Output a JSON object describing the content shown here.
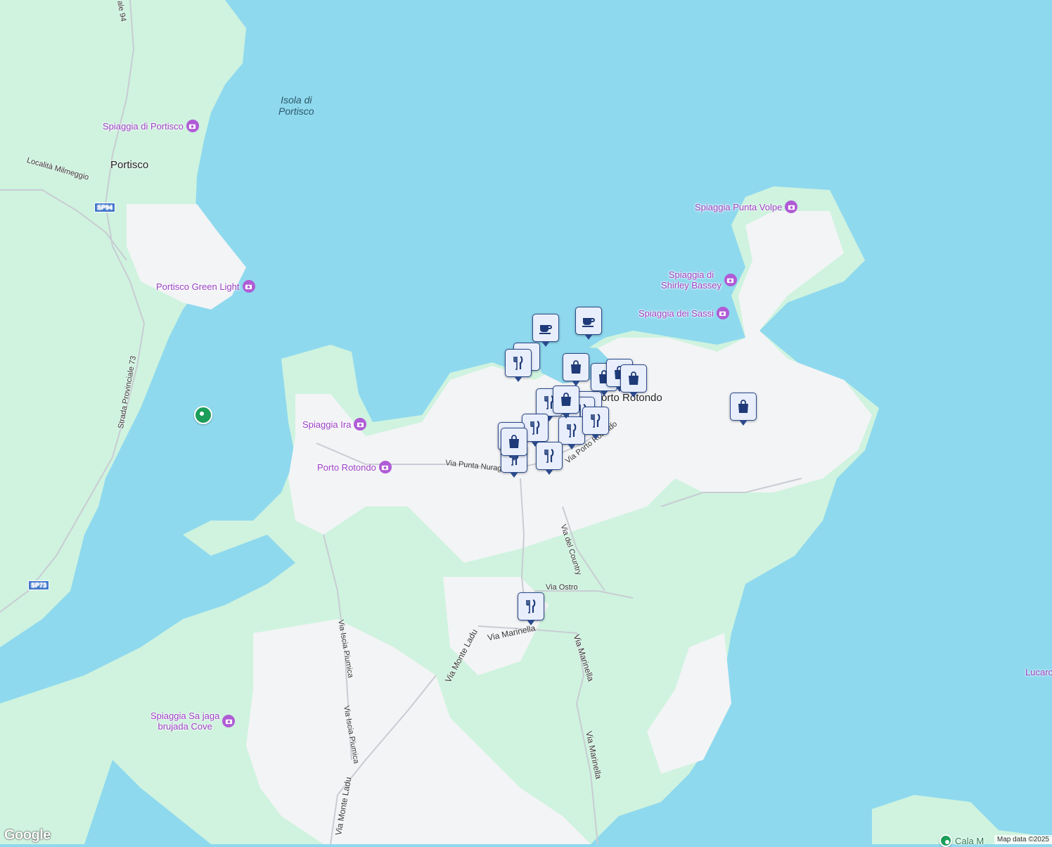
{
  "map": {
    "colors": {
      "water": "#8fd9ee",
      "land": "#f3f4f6",
      "park": "#cff3df",
      "road": "#c9ccd3",
      "poi": "#9a3fc4",
      "pin_border": "#2b4a8c",
      "pin_fill": "#e8eefc"
    },
    "place_labels": {
      "portisco": "Portisco",
      "porto_rotondo": "Porto Rotondo",
      "isola": "Isola di\nPortisco",
      "lucaro": "Lucaro"
    },
    "poi_labels": {
      "spiaggia_portisco": "Spiaggia di Portisco",
      "portisco_green_light": "Portisco Green Light",
      "spiaggia_punta_volpe": "Spiaggia Punta Volpe",
      "spiaggia_shirley_1": "Spiaggia di",
      "spiaggia_shirley_2": "Shirley Bassey",
      "spiaggia_sassi": "Spiaggia dei Sassi",
      "spiaggia_ira": "Spiaggia Ira",
      "porto_rotondo_poi": "Porto Rotondo",
      "sa_jaga_1": "Spiaggia Sa jaga",
      "sa_jaga_2": "brujada Cove",
      "cala_partial": "Cala M"
    },
    "road_labels": {
      "milmeggio": "Località Milmeggio",
      "sp94": "SP94",
      "sp73": "SP73",
      "provinciale_94": "ale 94",
      "provinciale_73": "Strada Provinciale 73",
      "punta_nuraghe": "Via Punta Nuraghe",
      "porto_rotondo_via": "Via Porto Rotondo",
      "del_country": "Via del Country",
      "ostro": "Via Ostro",
      "marinella_1": "Via Marinella",
      "marinella_2": "Via Marinella",
      "marinella_3": "Via Marinella",
      "monte_ladu_1": "Via Monte Ladu",
      "monte_ladu_2": "Via Monte Ladu",
      "iscia_1": "Via Iscia Piumica",
      "iscia_2": "Via Iscia Piumica"
    },
    "markers": [
      {
        "type": "cafe"
      },
      {
        "type": "cafe"
      },
      {
        "type": "restaurant"
      },
      {
        "type": "restaurant"
      },
      {
        "type": "restaurant"
      },
      {
        "type": "restaurant"
      },
      {
        "type": "restaurant"
      },
      {
        "type": "restaurant"
      },
      {
        "type": "restaurant"
      },
      {
        "type": "restaurant"
      },
      {
        "type": "restaurant"
      },
      {
        "type": "restaurant"
      },
      {
        "type": "restaurant"
      },
      {
        "type": "restaurant"
      },
      {
        "type": "shopping"
      },
      {
        "type": "shopping"
      },
      {
        "type": "shopping"
      },
      {
        "type": "shopping"
      },
      {
        "type": "shopping"
      },
      {
        "type": "shopping"
      },
      {
        "type": "shopping"
      }
    ],
    "logo": "Google",
    "attribution": "Map data ©2025"
  }
}
